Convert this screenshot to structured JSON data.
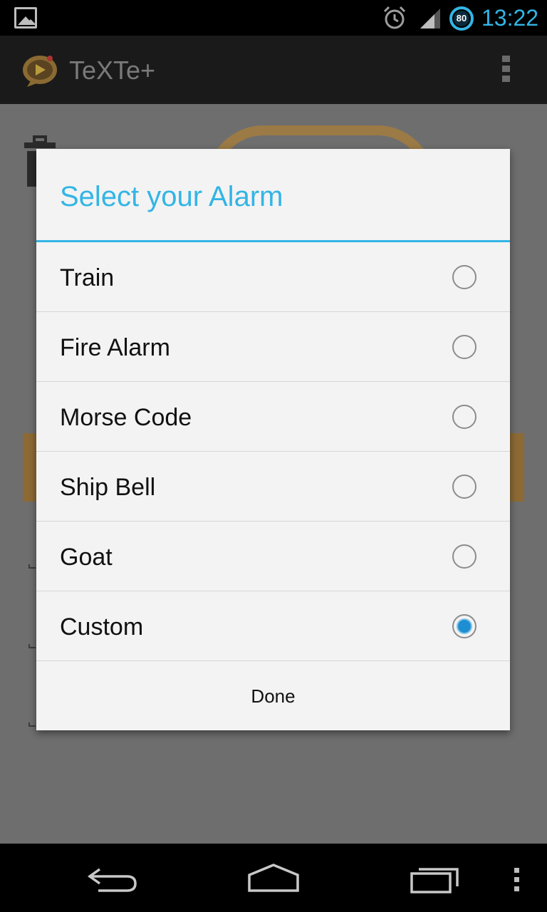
{
  "status_bar": {
    "time": "13:22",
    "battery_level": "80",
    "icons": [
      "image-notification-icon",
      "alarm-clock-icon",
      "signal-icon",
      "battery-icon"
    ]
  },
  "action_bar": {
    "app_title": "TeXTe+",
    "icons": [
      "app-logo-icon",
      "overflow-menu-icon"
    ]
  },
  "dialog": {
    "title": "Select your Alarm",
    "options": [
      {
        "label": "Train",
        "selected": false
      },
      {
        "label": "Fire Alarm",
        "selected": false
      },
      {
        "label": "Morse Code",
        "selected": false
      },
      {
        "label": "Ship Bell",
        "selected": false
      },
      {
        "label": "Goat",
        "selected": false
      },
      {
        "label": "Custom",
        "selected": true
      }
    ],
    "done_label": "Done"
  },
  "nav_bar": {
    "icons": [
      "back-icon",
      "home-icon",
      "recent-apps-icon",
      "menu-icon"
    ]
  },
  "colors": {
    "accent": "#33b5e5",
    "radio_selected": "#1d8ed1",
    "dialog_background": "#f3f3f3",
    "dimmed_background": "#6e6e6e"
  }
}
